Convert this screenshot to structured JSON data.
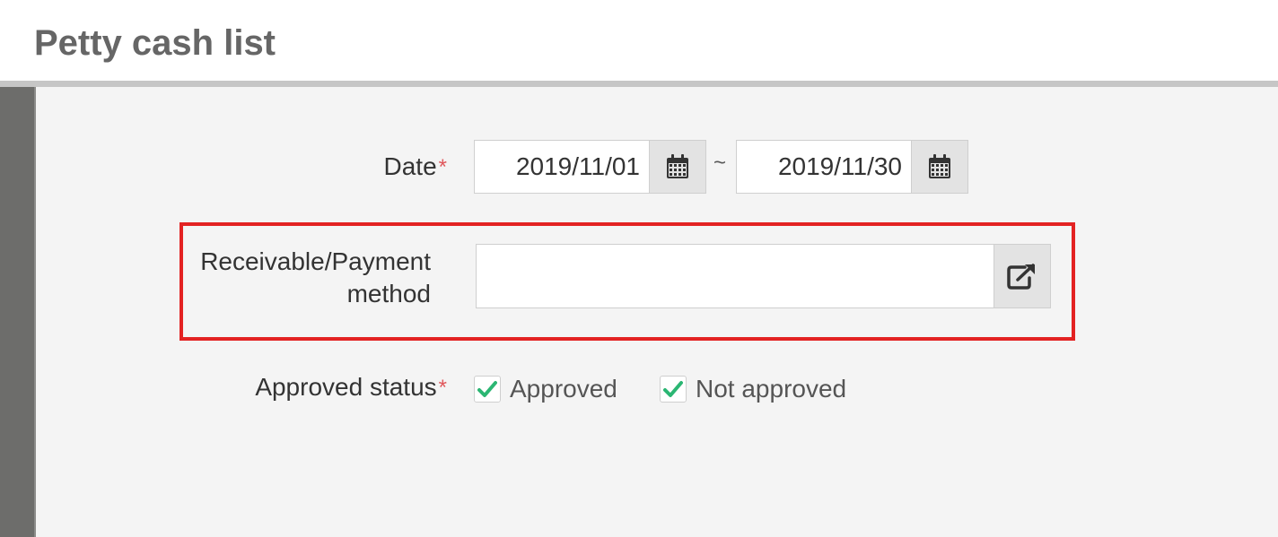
{
  "page": {
    "title": "Petty cash list"
  },
  "form": {
    "date": {
      "label": "Date",
      "required_mark": "*",
      "from": "2019/11/01",
      "separator": "~",
      "to": "2019/11/30",
      "calendar_icon": "calendar-icon"
    },
    "method": {
      "label_line1": "Receivable/Payment",
      "label_line2": "method",
      "value": "",
      "link_icon": "external-link-icon"
    },
    "approved_status": {
      "label": "Approved status",
      "required_mark": "*",
      "options": [
        {
          "label": "Approved",
          "checked": true
        },
        {
          "label": "Not approved",
          "checked": true
        }
      ]
    }
  },
  "colors": {
    "required": "#e0575b",
    "highlight": "#e32222",
    "check": "#2bb673"
  }
}
